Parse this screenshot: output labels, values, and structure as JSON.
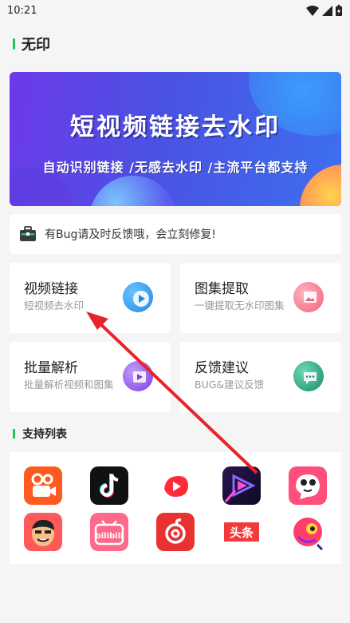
{
  "status": {
    "time": "10:21"
  },
  "appbar": {
    "title": "无印"
  },
  "banner": {
    "title": "短视频链接去水印",
    "subtitle": "自动识别链接 /无感去水印 /主流平台都支持"
  },
  "notice": {
    "text": "有Bug请及时反馈哦，会立刻修复!"
  },
  "cards": [
    {
      "title": "视频链接",
      "desc": "短视频去水印",
      "icon": "play-icon",
      "color": "#2196f3"
    },
    {
      "title": "图集提取",
      "desc": "一键提取无水印图集",
      "icon": "image-icon",
      "color": "#f06a7e"
    },
    {
      "title": "批量解析",
      "desc": "批量解析视频和图集",
      "icon": "folder-icon",
      "color": "#8e44e0"
    },
    {
      "title": "反馈建议",
      "desc": "BUG&建议反馈",
      "icon": "chat-icon",
      "color": "#1f9d7a"
    }
  ],
  "support": {
    "title": "支持列表",
    "apps": [
      {
        "name": "kuaishou-icon",
        "color": "#ff5a1f"
      },
      {
        "name": "douyin-icon",
        "color": "#111111"
      },
      {
        "name": "weishi-icon",
        "color": "#ff2b3a"
      },
      {
        "name": "video-app-icon",
        "color": "#1a1030"
      },
      {
        "name": "pipi-icon",
        "color": "#ff4f7a"
      },
      {
        "name": "face-app-icon",
        "color": "#ff5a5a"
      },
      {
        "name": "bilibili-icon",
        "color": "#ff6a8a"
      },
      {
        "name": "netease-music-icon",
        "color": "#e8322f"
      },
      {
        "name": "toutiao-icon",
        "color": "#f33a3a",
        "label": "头条"
      },
      {
        "name": "pipixia-icon",
        "color": "#ff3d6b"
      }
    ]
  }
}
